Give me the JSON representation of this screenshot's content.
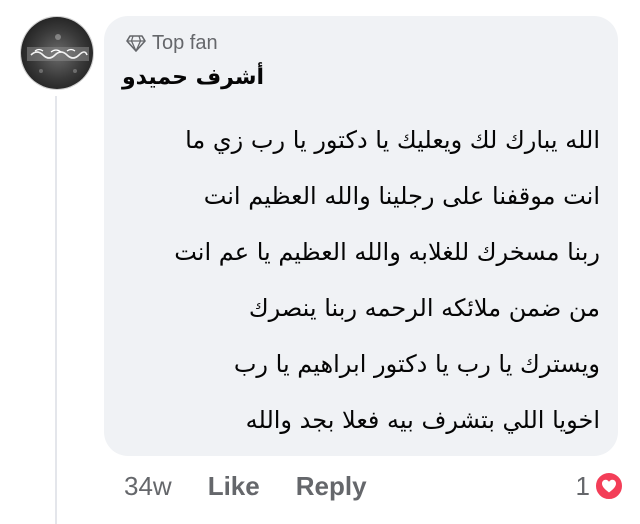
{
  "comment": {
    "badge_label": "Top fan",
    "author_name": "أشرف حميدو",
    "lines": [
      "الله يبارك لك ويعليك يا دكتور يا رب زي ما",
      "انت موقفنا على رجلينا والله العظيم انت",
      "ربنا مسخرك للغلابه والله العظيم يا عم انت",
      "من ضمن ملائكه الرحمه ربنا ينصرك",
      "ويسترك يا رب يا دكتور ابراهيم يا رب",
      "اخويا اللي بتشرف بيه فعلا بجد والله"
    ],
    "timestamp": "34w",
    "like_label": "Like",
    "reply_label": "Reply",
    "reaction_count": "1",
    "reaction_icon": "heart-icon",
    "badge_icon": "diamond-icon"
  },
  "colors": {
    "bubble_bg": "#f0f2f5",
    "secondary_text": "#65676b",
    "primary_text": "#050505",
    "heart_red": "#f33e58"
  }
}
